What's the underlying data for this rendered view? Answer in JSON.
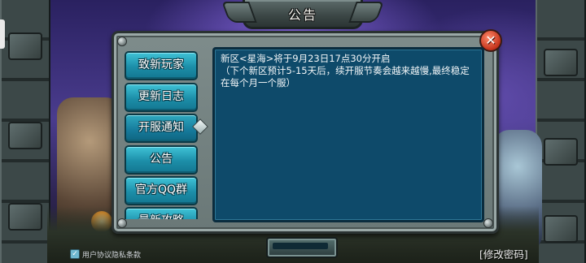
{
  "title": "公告",
  "tabs": [
    {
      "label": "致新玩家"
    },
    {
      "label": "更新日志"
    },
    {
      "label": "开服通知"
    },
    {
      "label": "公告"
    },
    {
      "label": "官方QQ群"
    },
    {
      "label": "最新攻略"
    }
  ],
  "active_tab_index": 2,
  "content": {
    "text": "新区<星海>将于9月23日17点30分开启\n（下个新区预计5-15天后，续开服节奏会越来越慢,最终稳定在每个月一个服）"
  },
  "footer": {
    "privacy_label": "用户协议隐私条款",
    "privacy_checked": true,
    "change_password": "[修改密码]"
  },
  "close_icon": "close-x-icon",
  "colors": {
    "tab": "#1c8ea8",
    "content_bg": "#0e4a6a",
    "close": "#c3321b"
  }
}
